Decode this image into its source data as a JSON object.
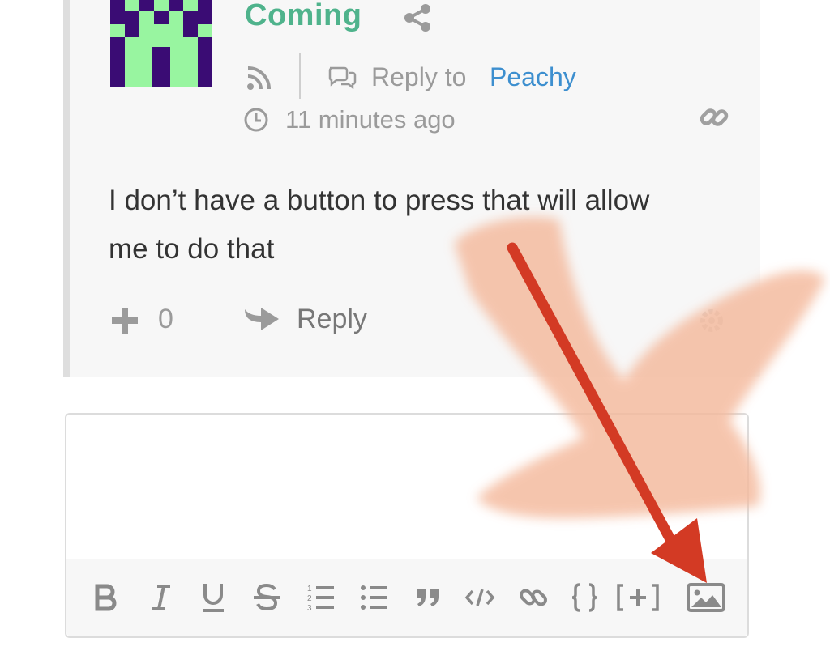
{
  "comment": {
    "author": "Coming",
    "reply_to_label": "Reply to",
    "reply_to_name": "Peachy",
    "timestamp": "11 minutes ago",
    "body": "I don’t have a button to press that will allow me to do that",
    "vote_count": "0",
    "reply_label": "Reply"
  },
  "editor": {
    "toolbar": [
      "bold-icon",
      "italic-icon",
      "underline-icon",
      "strikethrough-icon",
      "ordered-list-icon",
      "unordered-list-icon",
      "blockquote-icon",
      "code-icon",
      "link-icon",
      "code-block-icon",
      "spoiler-icon",
      "image-icon"
    ]
  },
  "colors": {
    "author": "#4fb38c",
    "link": "#3d8fcf",
    "annotation_arrow": "#d33a24",
    "annotation_highlight": "#f4b99c"
  }
}
